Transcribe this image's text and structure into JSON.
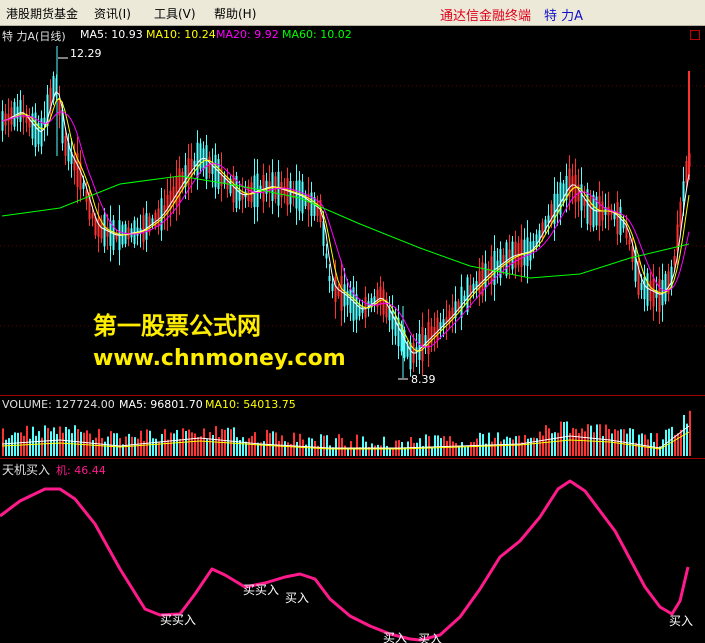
{
  "menu": {
    "items": [
      "港股期货基金",
      "资讯(I)",
      "工具(V)",
      "帮助(H)"
    ],
    "brand": "通达信金融终端",
    "stock_label": "特    力A"
  },
  "main_chart": {
    "title": "特    力A(日线)",
    "ma5": "MA5: 10.93",
    "ma10": "MA10: 10.24",
    "ma20": "MA20: 9.92",
    "ma60": "MA60: 10.02",
    "high_label": "12.29",
    "low_label": "8.39",
    "colors": {
      "ma5": "#ffffff",
      "ma10": "#ffff00",
      "ma20": "#ff00ff",
      "ma60": "#00ff00",
      "up": "#ff3232",
      "down": "#54ffff"
    }
  },
  "volume_panel": {
    "volume": "VOLUME: 127724.00",
    "ma5": "MA5: 96801.70",
    "ma10": "MA10: 54013.75"
  },
  "indicator_panel": {
    "name": "天机买入",
    "value_label": "机: 46.44",
    "buy_labels": [
      "买买入",
      "买买入",
      "买入",
      "买入",
      "买入",
      "买入"
    ],
    "line_color": "#ff1a8c"
  },
  "watermark": {
    "line1": "第一股票公式网",
    "line2": "www.chnmoney.com"
  }
}
